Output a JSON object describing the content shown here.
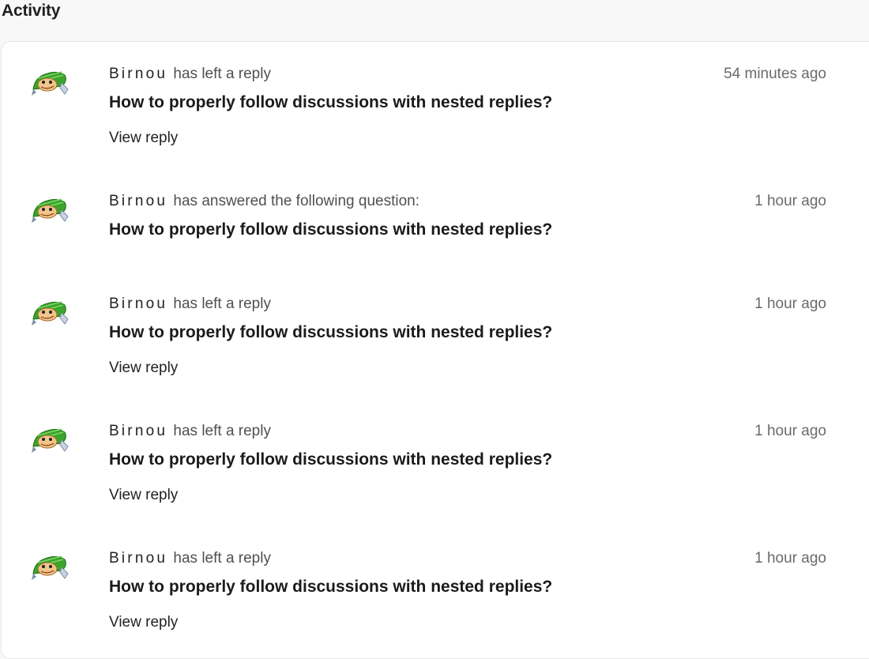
{
  "section": {
    "title": "Activity"
  },
  "activities": [
    {
      "author": "Birnou",
      "action": "has left a reply",
      "time": "54 minutes ago",
      "headline": "How to properly follow discussions with nested replies?",
      "link": "View reply"
    },
    {
      "author": "Birnou",
      "action": "has answered the following question:",
      "time": "1 hour ago",
      "headline": "How to properly follow discussions with nested replies?",
      "link": ""
    },
    {
      "author": "Birnou",
      "action": "has left a reply",
      "time": "1 hour ago",
      "headline": "How to properly follow discussions with nested replies?",
      "link": "View reply"
    },
    {
      "author": "Birnou",
      "action": "has left a reply",
      "time": "1 hour ago",
      "headline": "How to properly follow discussions with nested replies?",
      "link": "View reply"
    },
    {
      "author": "Birnou",
      "action": "has left a reply",
      "time": "1 hour ago",
      "headline": "How to properly follow discussions with nested replies?",
      "link": "View reply"
    }
  ],
  "icons": {
    "avatar": "frog-avatar-icon"
  },
  "colors": {
    "avatar_green": "#3aa52a",
    "avatar_face": "#f2c58a"
  }
}
